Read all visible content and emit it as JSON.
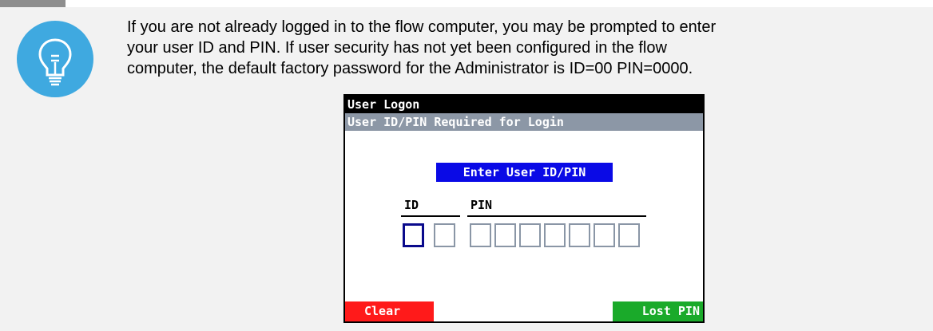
{
  "note": {
    "text_line1": "If you are not already logged in to the flow computer, you may be prompted to enter",
    "text_line2": "your user ID and PIN. If user security has not yet been configured in the flow",
    "text_line3": "computer, the default factory password for the Administrator is ID=00 PIN=0000.",
    "icon": "lightbulb-icon"
  },
  "screen": {
    "title": "User Logon",
    "subtitle": "User ID/PIN Required for Login",
    "prompt": "Enter User ID/PIN",
    "id_label": "ID",
    "pin_label": "PIN",
    "clear_label": "Clear",
    "lost_pin_label": "Lost PIN"
  },
  "colors": {
    "icon_circle": "#3fa9e0",
    "title_bar": "#000000",
    "subtitle_bar": "#8c97a6",
    "prompt_bg": "#0a0ae6",
    "clear_button": "#ff1a1a",
    "lost_pin_button": "#1aaa2a"
  }
}
